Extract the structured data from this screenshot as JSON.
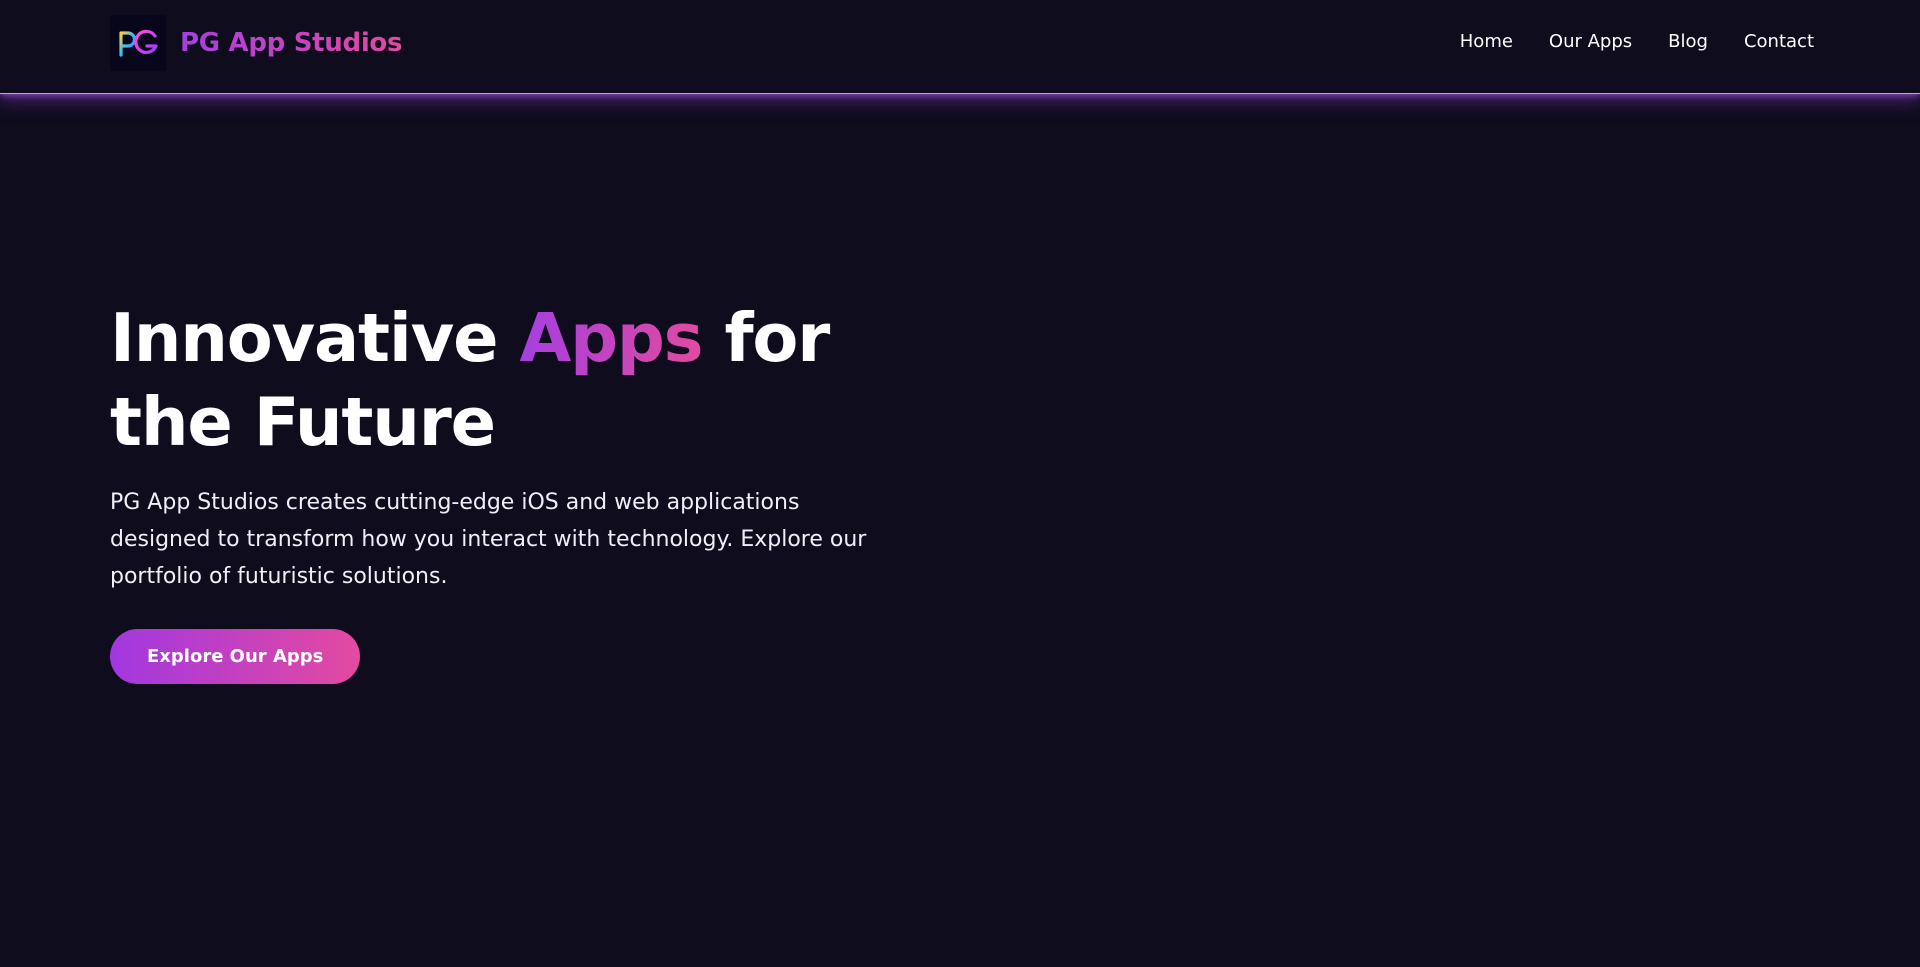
{
  "brand": {
    "name": "PG App Studios",
    "logo_icon": "pg-logo-icon",
    "gradient": [
      "#a63fe0",
      "#e14aa0"
    ]
  },
  "nav": {
    "items": [
      {
        "label": "Home"
      },
      {
        "label": "Our Apps"
      },
      {
        "label": "Blog"
      },
      {
        "label": "Contact"
      }
    ]
  },
  "hero": {
    "title_before": "Innovative ",
    "title_accent": "Apps",
    "title_after": " for the Future",
    "subtitle": "PG App Studios creates cutting-edge iOS and web applications designed to transform how you interact with technology. Explore our portfolio of futuristic solutions.",
    "cta_label": "Explore Our Apps"
  },
  "colors": {
    "background": "#0f0c1d",
    "header_glow": "#c79bf2",
    "accent_start": "#a63fe0",
    "accent_end": "#e14aa0"
  }
}
